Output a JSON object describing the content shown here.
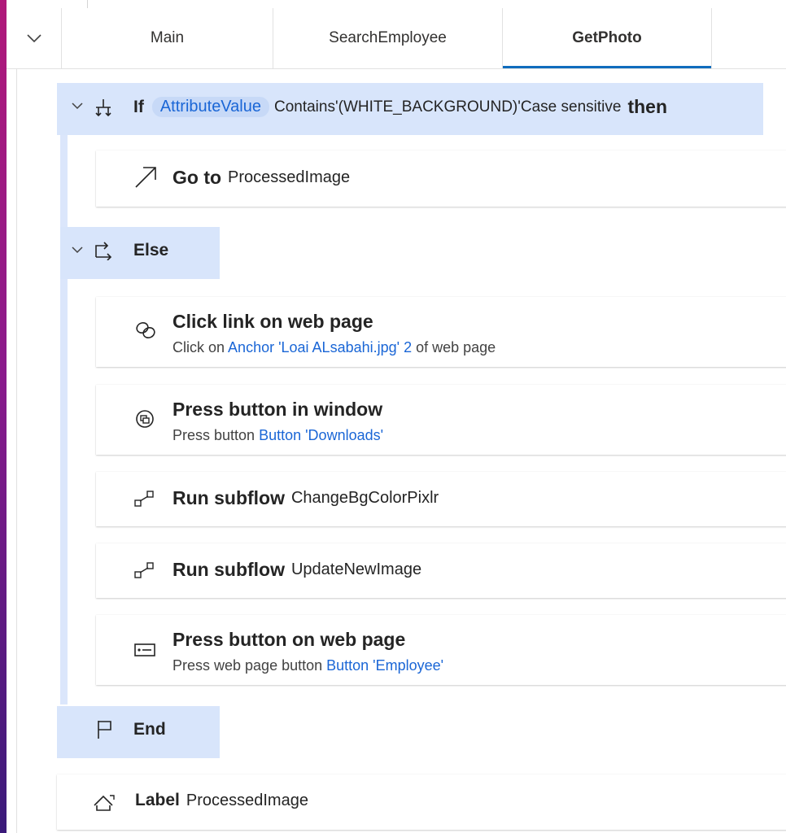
{
  "tabs": [
    {
      "label": "Main",
      "active": false
    },
    {
      "label": "SearchEmployee",
      "active": false
    },
    {
      "label": "GetPhoto",
      "active": true
    }
  ],
  "if_block": {
    "keyword": "If",
    "variable": "AttributeValue",
    "operator": "Contains",
    "quote_open": "'",
    "value": "(WHITE_BACKGROUND)",
    "quote_close": "'",
    "case_text": "Case sensitive",
    "then": "then"
  },
  "goto_action": {
    "title": "Go to",
    "target": "ProcessedImage"
  },
  "else_block": {
    "label": "Else"
  },
  "click_link_action": {
    "title": "Click link on web page",
    "sub_prefix": "Click on",
    "sub_link": "Anchor 'Loai ALsabahi.jpg' 2",
    "sub_suffix": "of web page"
  },
  "press_window_action": {
    "title": "Press button in window",
    "sub_prefix": "Press button",
    "sub_link": "Button 'Downloads'"
  },
  "subflow_1": {
    "title": "Run subflow",
    "target": "ChangeBgColorPixlr"
  },
  "subflow_2": {
    "title": "Run subflow",
    "target": "UpdateNewImage"
  },
  "press_web_action": {
    "title": "Press button on web page",
    "sub_prefix": "Press web page button",
    "sub_link": "Button 'Employee'"
  },
  "end_block": {
    "label": "End"
  },
  "label_action": {
    "title": "Label",
    "target": "ProcessedImage"
  },
  "colors": {
    "accent": "#0f6cbd",
    "link": "#1a66d6",
    "header_bg": "#d8e5fb",
    "chip_bg": "#c7d9f7"
  }
}
